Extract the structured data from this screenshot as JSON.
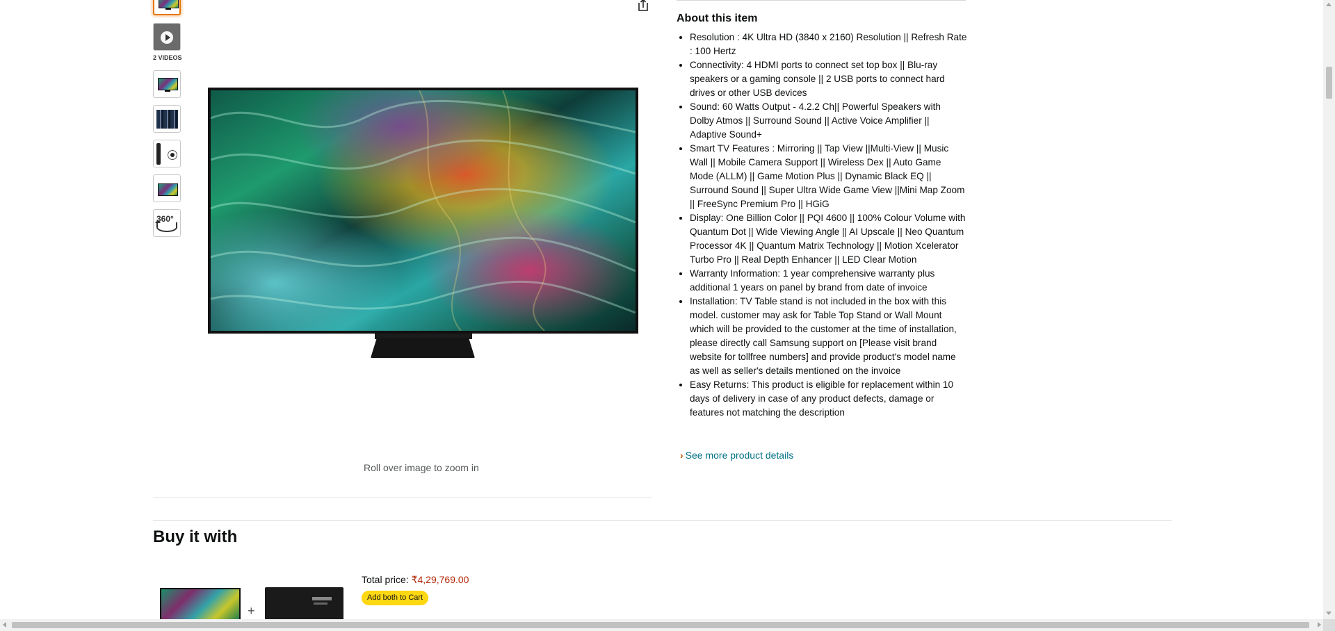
{
  "gallery": {
    "videos_label": "2 VIDEOS",
    "spin_label": "360°",
    "zoom_hint": "Roll over image to zoom in"
  },
  "about": {
    "title": "About this item",
    "bullets": [
      "Resolution : 4K Ultra HD (3840 x 2160) Resolution || Refresh Rate : 100 Hertz",
      "Connectivity: 4 HDMI ports to connect set top box || Blu-ray speakers or a gaming console || 2 USB ports to connect hard drives or other USB devices",
      "Sound: 60 Watts Output - 4.2.2 Ch|| Powerful Speakers with Dolby Atmos || Surround Sound || Active Voice Amplifier || Adaptive Sound+",
      "Smart TV Features : Mirroring || Tap View ||Multi-View || Music Wall || Mobile Camera Support || Wireless Dex || Auto Game Mode (ALLM) || Game Motion Plus || Dynamic Black EQ || Surround Sound || Super Ultra Wide Game View ||Mini Map Zoom || FreeSync Premium Pro || HGiG",
      "Display: One Billion Color || PQI 4600 || 100% Colour Volume with Quantum Dot || Wide Viewing Angle || AI Upscale || Neo Quantum Processor 4K || Quantum Matrix Technology || Motion Xcelerator Turbo Pro || Real Depth Enhancer || LED Clear Motion",
      "Warranty Information: 1 year comprehensive warranty plus additional 1 years on panel by brand from date of invoice",
      "Installation: TV Table stand is not included in the box with this model. customer may ask for Table Top Stand or Wall Mount which will be provided to the customer at the time of installation, please directly call Samsung support on [Please visit brand website for tollfree numbers] and provide product's model name as well as seller's details mentioned on the invoice",
      "Easy Returns: This product is eligible for replacement within 10 days of delivery in case of any product defects, damage or features not matching the description"
    ],
    "see_more": "See more product details"
  },
  "buy_it_with": {
    "title": "Buy it with",
    "plus": "+",
    "total_label": "Total price:",
    "total_price": "₹4,29,769.00",
    "add_both_label": "Add both to Cart"
  },
  "colors": {
    "link": "#007185",
    "price": "#b12704",
    "button": "#ffd814",
    "selected_thumb": "#e77600"
  }
}
